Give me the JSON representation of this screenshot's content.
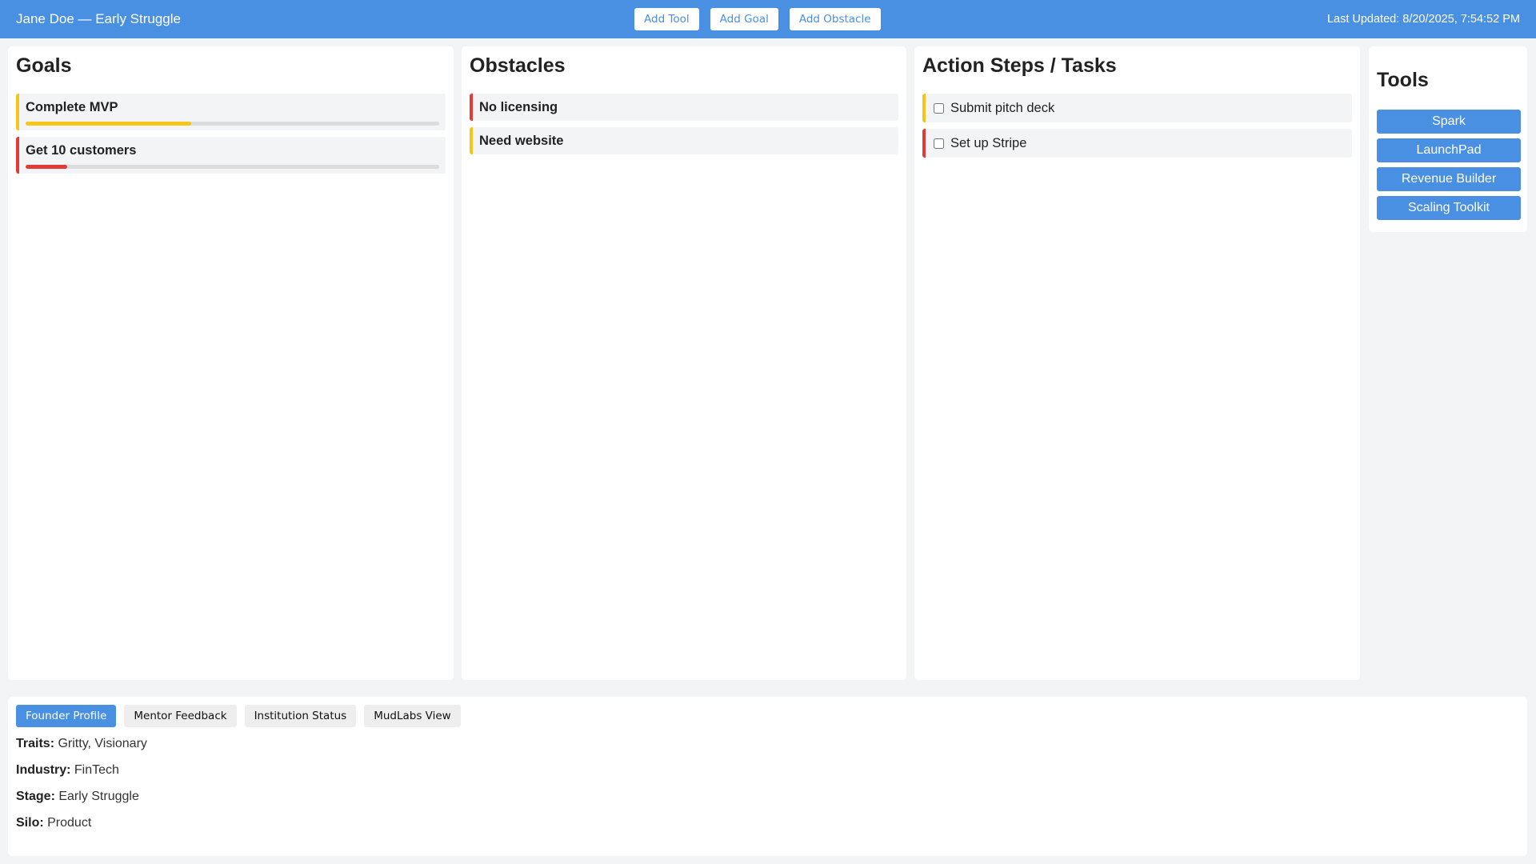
{
  "header": {
    "title": "Jane Doe — Early Struggle",
    "last_updated": "Last Updated: 8/20/2025, 7:54:52 PM",
    "actions": [
      "Add Tool",
      "Add Goal",
      "Add Obstacle"
    ]
  },
  "goals": {
    "heading": "Goals",
    "items": [
      {
        "label": "Complete MVP",
        "progress": 0.4,
        "color": "#f5c518"
      },
      {
        "label": "Get 10 customers",
        "progress": 0.1,
        "color": "#e53935"
      }
    ]
  },
  "obstacles": {
    "heading": "Obstacles",
    "items": [
      {
        "label": "No licensing",
        "color": "#e53935"
      },
      {
        "label": "Need website",
        "color": "#f5c518"
      }
    ]
  },
  "tasks": {
    "heading": "Action Steps / Tasks",
    "items": [
      {
        "label": "Submit pitch deck",
        "checked": false,
        "color": "#f5c518"
      },
      {
        "label": "Set up Stripe",
        "checked": false,
        "color": "#e53935"
      }
    ]
  },
  "tools": {
    "heading": "Tools",
    "items": [
      "Spark",
      "LaunchPad",
      "Revenue Builder",
      "Scaling Toolkit"
    ]
  },
  "profile": {
    "tabs": [
      "Founder Profile",
      "Mentor Feedback",
      "Institution Status",
      "MudLabs View"
    ],
    "active_tab": "Founder Profile",
    "fields": [
      {
        "key": "Traits:",
        "value": "Gritty, Visionary"
      },
      {
        "key": "Industry:",
        "value": "FinTech"
      },
      {
        "key": "Stage:",
        "value": "Early Struggle"
      },
      {
        "key": "Silo:",
        "value": "Product"
      }
    ]
  },
  "colors": {
    "accent": "#4a90e2",
    "warning": "#f5c518",
    "danger": "#e53935"
  }
}
